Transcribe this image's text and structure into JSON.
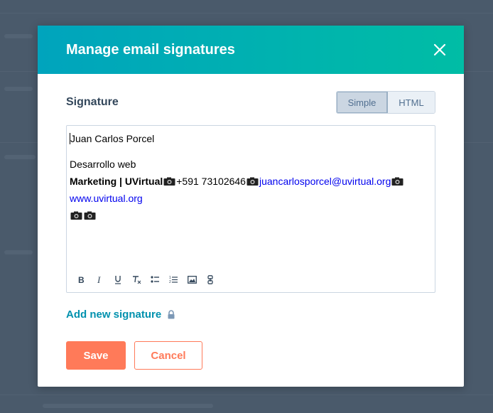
{
  "modal": {
    "title": "Manage email signatures"
  },
  "signature": {
    "label": "Signature",
    "mode_options": [
      "Simple",
      "HTML"
    ],
    "selected_mode": "Simple"
  },
  "editor": {
    "name": "Juan Carlos Porcel",
    "role": "Desarrollo web",
    "company": "Marketing | UVirtual",
    "phone": "+591 73102646",
    "email": "juancarlosporcel@uvirtual.org",
    "website": "www.uvirtual.org",
    "toolbar": [
      "bold-icon",
      "italic-icon",
      "underline-icon",
      "clear-format-icon",
      "bulleted-list-icon",
      "numbered-list-icon",
      "image-icon",
      "link-icon"
    ]
  },
  "add_signature": {
    "label": "Add new signature",
    "icon": "lock-icon"
  },
  "footer": {
    "save_label": "Save",
    "cancel_label": "Cancel"
  },
  "colors": {
    "header_gradient_start": "#00a4bd",
    "header_gradient_end": "#00bda5",
    "primary": "#ff7a59",
    "link": "#0091ae",
    "text": "#33475b"
  }
}
